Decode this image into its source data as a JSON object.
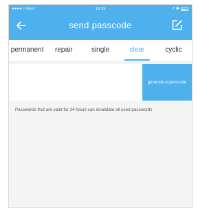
{
  "status_bar": {
    "carrier": "●●●●○ A&AT",
    "time": "16:59",
    "indicators": "↗ ✱"
  },
  "header": {
    "title": "send passcode",
    "back_icon": "arrow-left-icon",
    "action_icon": "edit-icon",
    "background_color": "#4fb0ee"
  },
  "tabs": [
    {
      "label": "permanent",
      "active": false
    },
    {
      "label": "repair",
      "active": false
    },
    {
      "label": "single",
      "active": false
    },
    {
      "label": "clear",
      "active": true
    },
    {
      "label": "cyclic",
      "active": false
    }
  ],
  "generate": {
    "passcode_value": "",
    "button_label": "generate a passcode"
  },
  "note": "Passwords that are valid for 24 hours can invalidate all used passwords"
}
